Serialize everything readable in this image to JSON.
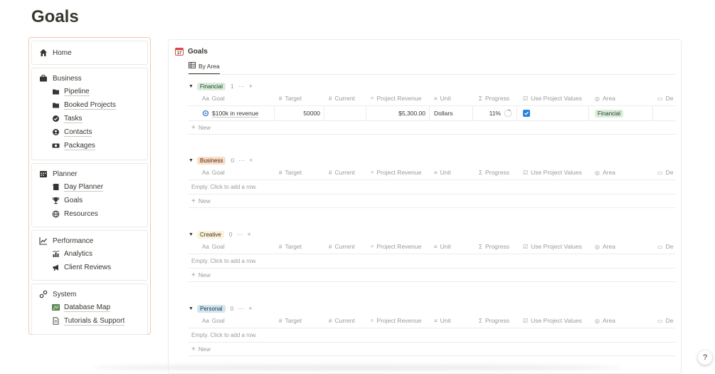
{
  "page": {
    "title": "Goals"
  },
  "sidebar": {
    "home": {
      "label": "Home",
      "icon": "home-icon"
    },
    "sections": [
      {
        "label": "Business",
        "icon": "briefcase-icon",
        "items": [
          {
            "label": "Pipeline",
            "icon": "folder-icon"
          },
          {
            "label": "Booked Projects",
            "icon": "folder-icon"
          },
          {
            "label": "Tasks",
            "icon": "check-circle-icon"
          },
          {
            "label": "Contacts",
            "icon": "user-circle-icon"
          },
          {
            "label": "Packages",
            "icon": "money-icon"
          }
        ]
      },
      {
        "label": "Planner",
        "icon": "calendar-icon",
        "items": [
          {
            "label": "Day Planner",
            "icon": "notebook-icon"
          },
          {
            "label": "Goals",
            "icon": "trophy-icon"
          },
          {
            "label": "Resources",
            "icon": "globe-icon"
          }
        ]
      },
      {
        "label": "Performance",
        "icon": "chart-icon",
        "items": [
          {
            "label": "Analytics",
            "icon": "bar-chart-icon"
          },
          {
            "label": "Client Reviews",
            "icon": "megaphone-icon"
          }
        ]
      },
      {
        "label": "System",
        "icon": "gears-icon",
        "items": [
          {
            "label": "Database Map",
            "icon": "map-icon"
          },
          {
            "label": "Tutorials & Support",
            "icon": "document-icon"
          }
        ]
      }
    ]
  },
  "database": {
    "title": "Goals",
    "icon": "calendar-icon",
    "view_tab": "By Area",
    "columns": {
      "goal": "Goal",
      "target": "Target",
      "current": "Current",
      "revenue": "Project Revenue",
      "unit": "Unit",
      "progress": "Progress",
      "use": "Use Project Values",
      "area": "Area",
      "date": "De"
    },
    "column_icons": {
      "goal": "Aa",
      "target": "#",
      "current": "#",
      "revenue": "⌕",
      "unit": "≡",
      "progress": "Σ",
      "use": "☑",
      "area": "◎",
      "date": "▭"
    },
    "empty_text": "Empty. Click to add a row.",
    "new_label": "New",
    "more_label": "···",
    "add_label": "+",
    "groups": [
      {
        "name": "Financial",
        "count": "1",
        "pill_bg": "#dbeddb",
        "pill_fg": "#1c3829",
        "rows": [
          {
            "goal": "$100k in revenue",
            "target": "50000",
            "current": "",
            "revenue": "$5,300.00",
            "unit": "Dollars",
            "progress": "11%",
            "use_checked": true,
            "area": "Financial"
          }
        ]
      },
      {
        "name": "Business",
        "count": "0",
        "pill_bg": "#fadec9",
        "pill_fg": "#49290e",
        "rows": []
      },
      {
        "name": "Creative",
        "count": "0",
        "pill_bg": "#fbf3db",
        "pill_fg": "#402c1b",
        "rows": []
      },
      {
        "name": "Personal",
        "count": "0",
        "pill_bg": "#d3e5ef",
        "pill_fg": "#183347",
        "rows": []
      }
    ]
  },
  "help": {
    "label": "?"
  },
  "colors": {
    "accent": "#2383e2",
    "sidebar_border": "#f0c8b4"
  }
}
